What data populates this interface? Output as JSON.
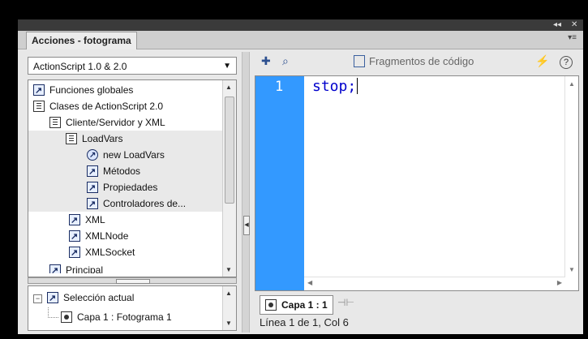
{
  "window": {
    "collapse_label": "◂◂",
    "close_label": "✕",
    "tab_title": "Acciones - fotograma",
    "tab_menu": "▾≡"
  },
  "language_select": {
    "value": "ActionScript 1.0 & 2.0"
  },
  "tree": {
    "items": [
      {
        "label": "Funciones globales",
        "icon": "arrowbox-icon"
      },
      {
        "label": "Clases de ActionScript 2.0",
        "icon": "book-icon"
      },
      {
        "label": "Cliente/Servidor y XML",
        "icon": "book-icon"
      },
      {
        "label": "LoadVars",
        "icon": "book-icon"
      },
      {
        "label": "new LoadVars",
        "icon": "constructor-icon"
      },
      {
        "label": "Métodos",
        "icon": "arrowbox-icon"
      },
      {
        "label": "Propiedades",
        "icon": "arrowbox-icon"
      },
      {
        "label": "Controladores de...",
        "icon": "arrowbox-icon"
      },
      {
        "label": "XML",
        "icon": "arrowbox-icon"
      },
      {
        "label": "XMLNode",
        "icon": "arrowbox-icon"
      },
      {
        "label": "XMLSocket",
        "icon": "arrowbox-icon"
      },
      {
        "label": "Principal",
        "icon": "arrowbox-icon"
      }
    ]
  },
  "selection": {
    "root_label": "Selección actual",
    "child_label": "Capa 1 : Fotograma 1"
  },
  "toolbar": {
    "add_icon": "✚",
    "find_icon": "⌕",
    "snippets_label": "Fragmentos de código",
    "wand_icon": "⚡",
    "help_icon": "?"
  },
  "editor": {
    "line_number": "1",
    "code": "stop;"
  },
  "layer_tab": {
    "label": "Capa 1 : 1"
  },
  "status": {
    "text": "Línea 1 de 1, Col 6"
  }
}
